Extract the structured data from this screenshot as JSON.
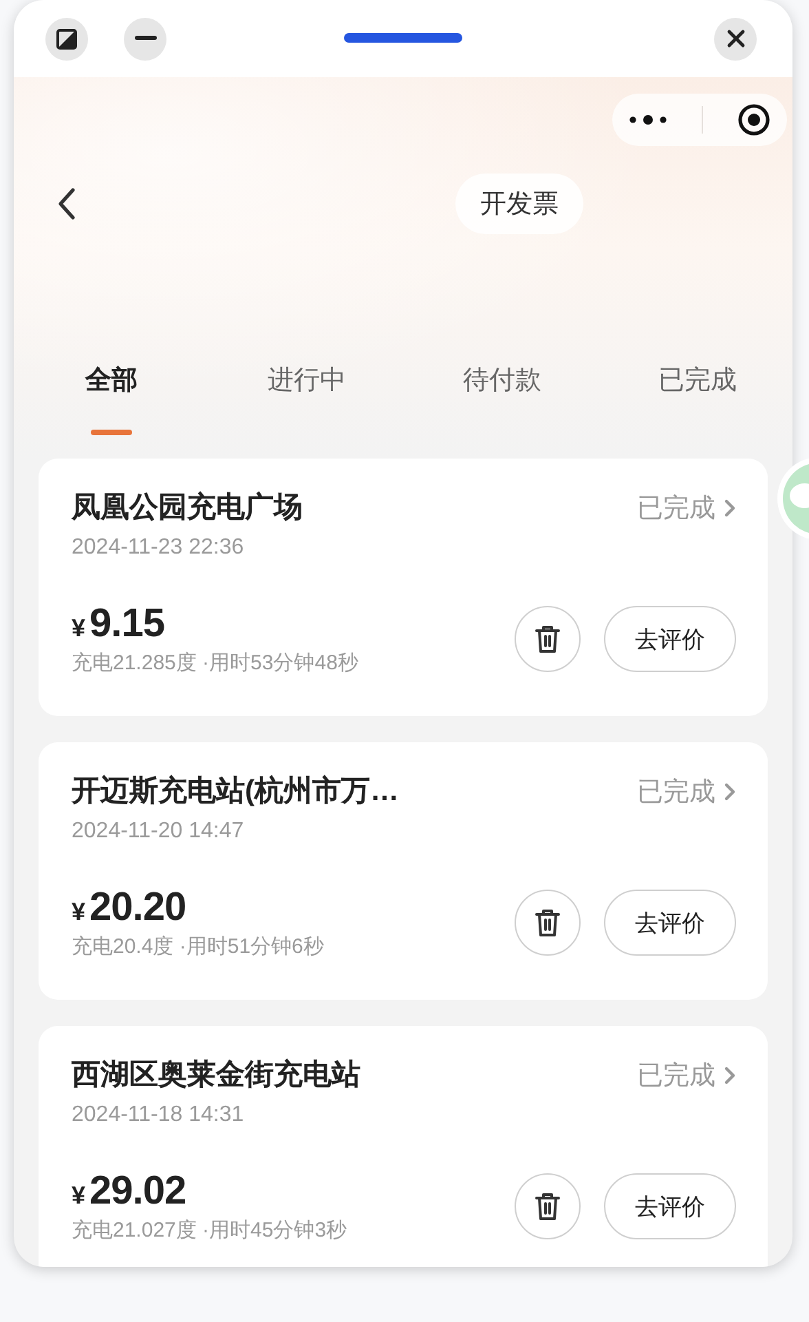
{
  "header": {
    "invoice_button": "开发票"
  },
  "tabs": [
    {
      "label": "全部",
      "selected": true
    },
    {
      "label": "进行中",
      "selected": false
    },
    {
      "label": "待付款",
      "selected": false
    },
    {
      "label": "已完成",
      "selected": false
    }
  ],
  "orders": [
    {
      "station": "凤凰公园充电广场",
      "status": "已完成",
      "time": "2024-11-23 22:36",
      "currency": "¥",
      "amount": "9.15",
      "details": "充电21.285度 ·用时53分钟48秒",
      "review_button": "去评价"
    },
    {
      "station": "开迈斯充电站(杭州市万…",
      "status": "已完成",
      "time": "2024-11-20 14:47",
      "currency": "¥",
      "amount": "20.20",
      "details": "充电20.4度 ·用时51分钟6秒",
      "review_button": "去评价"
    },
    {
      "station": "西湖区奥莱金街充电站",
      "status": "已完成",
      "time": "2024-11-18 14:31",
      "currency": "¥",
      "amount": "29.02",
      "details": "充电21.027度 ·用时45分钟3秒",
      "review_button": "去评价"
    }
  ]
}
